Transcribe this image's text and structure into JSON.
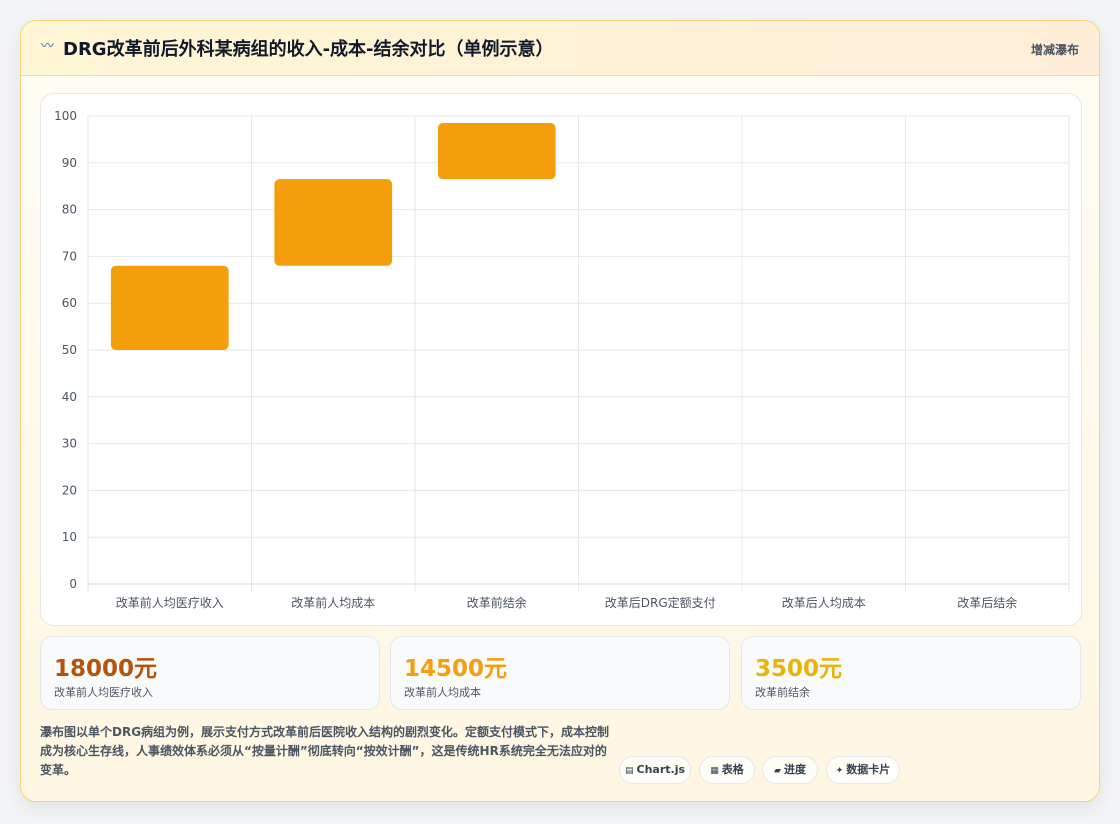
{
  "header": {
    "title": "DRG改革前后外科某病组的收入-成本-结余对比（单例示意）",
    "chart_type_label": "增减瀑布",
    "icon": "wave-icon"
  },
  "chart_data": {
    "type": "bar",
    "subtype": "floating-bar",
    "categories": [
      "改革前人均医疗收入",
      "改革前人均成本",
      "改革前结余",
      "改革后DRG定额支付",
      "改革后人均成本",
      "改革后结余"
    ],
    "ranges": [
      [
        50,
        68
      ],
      [
        68,
        86.5
      ],
      [
        86.5,
        98.5
      ],
      null,
      null,
      null
    ],
    "ylim": [
      0,
      100
    ],
    "yticks": [
      0,
      10,
      20,
      30,
      40,
      50,
      60,
      70,
      80,
      90,
      100
    ],
    "grid": true,
    "bar_color": "#f59e0b"
  },
  "kpis": [
    {
      "value": "18000元",
      "label": "改革前人均医疗收入",
      "color": "#b45309"
    },
    {
      "value": "14500元",
      "label": "改革前人均成本",
      "color": "#f59e0b"
    },
    {
      "value": "3500元",
      "label": "改革前结余",
      "color": "#eab308"
    }
  ],
  "description": "瀑布图以单个DRG病组为例，展示支付方式改革前后医院收入结构的剧烈变化。定额支付模式下，成本控制成为核心生存线，人事绩效体系必须从“按量计酬”彻底转向“按效计酬”，这是传统HR系统完全无法应对的变革。",
  "actions": [
    {
      "label": "Chart.js",
      "icon": "chart-icon",
      "glyph": "▤"
    },
    {
      "label": "表格",
      "icon": "table-icon",
      "glyph": "▦"
    },
    {
      "label": "进度",
      "icon": "progress-icon",
      "glyph": "▰"
    },
    {
      "label": "数据卡片",
      "icon": "card-icon",
      "glyph": "✦"
    }
  ]
}
